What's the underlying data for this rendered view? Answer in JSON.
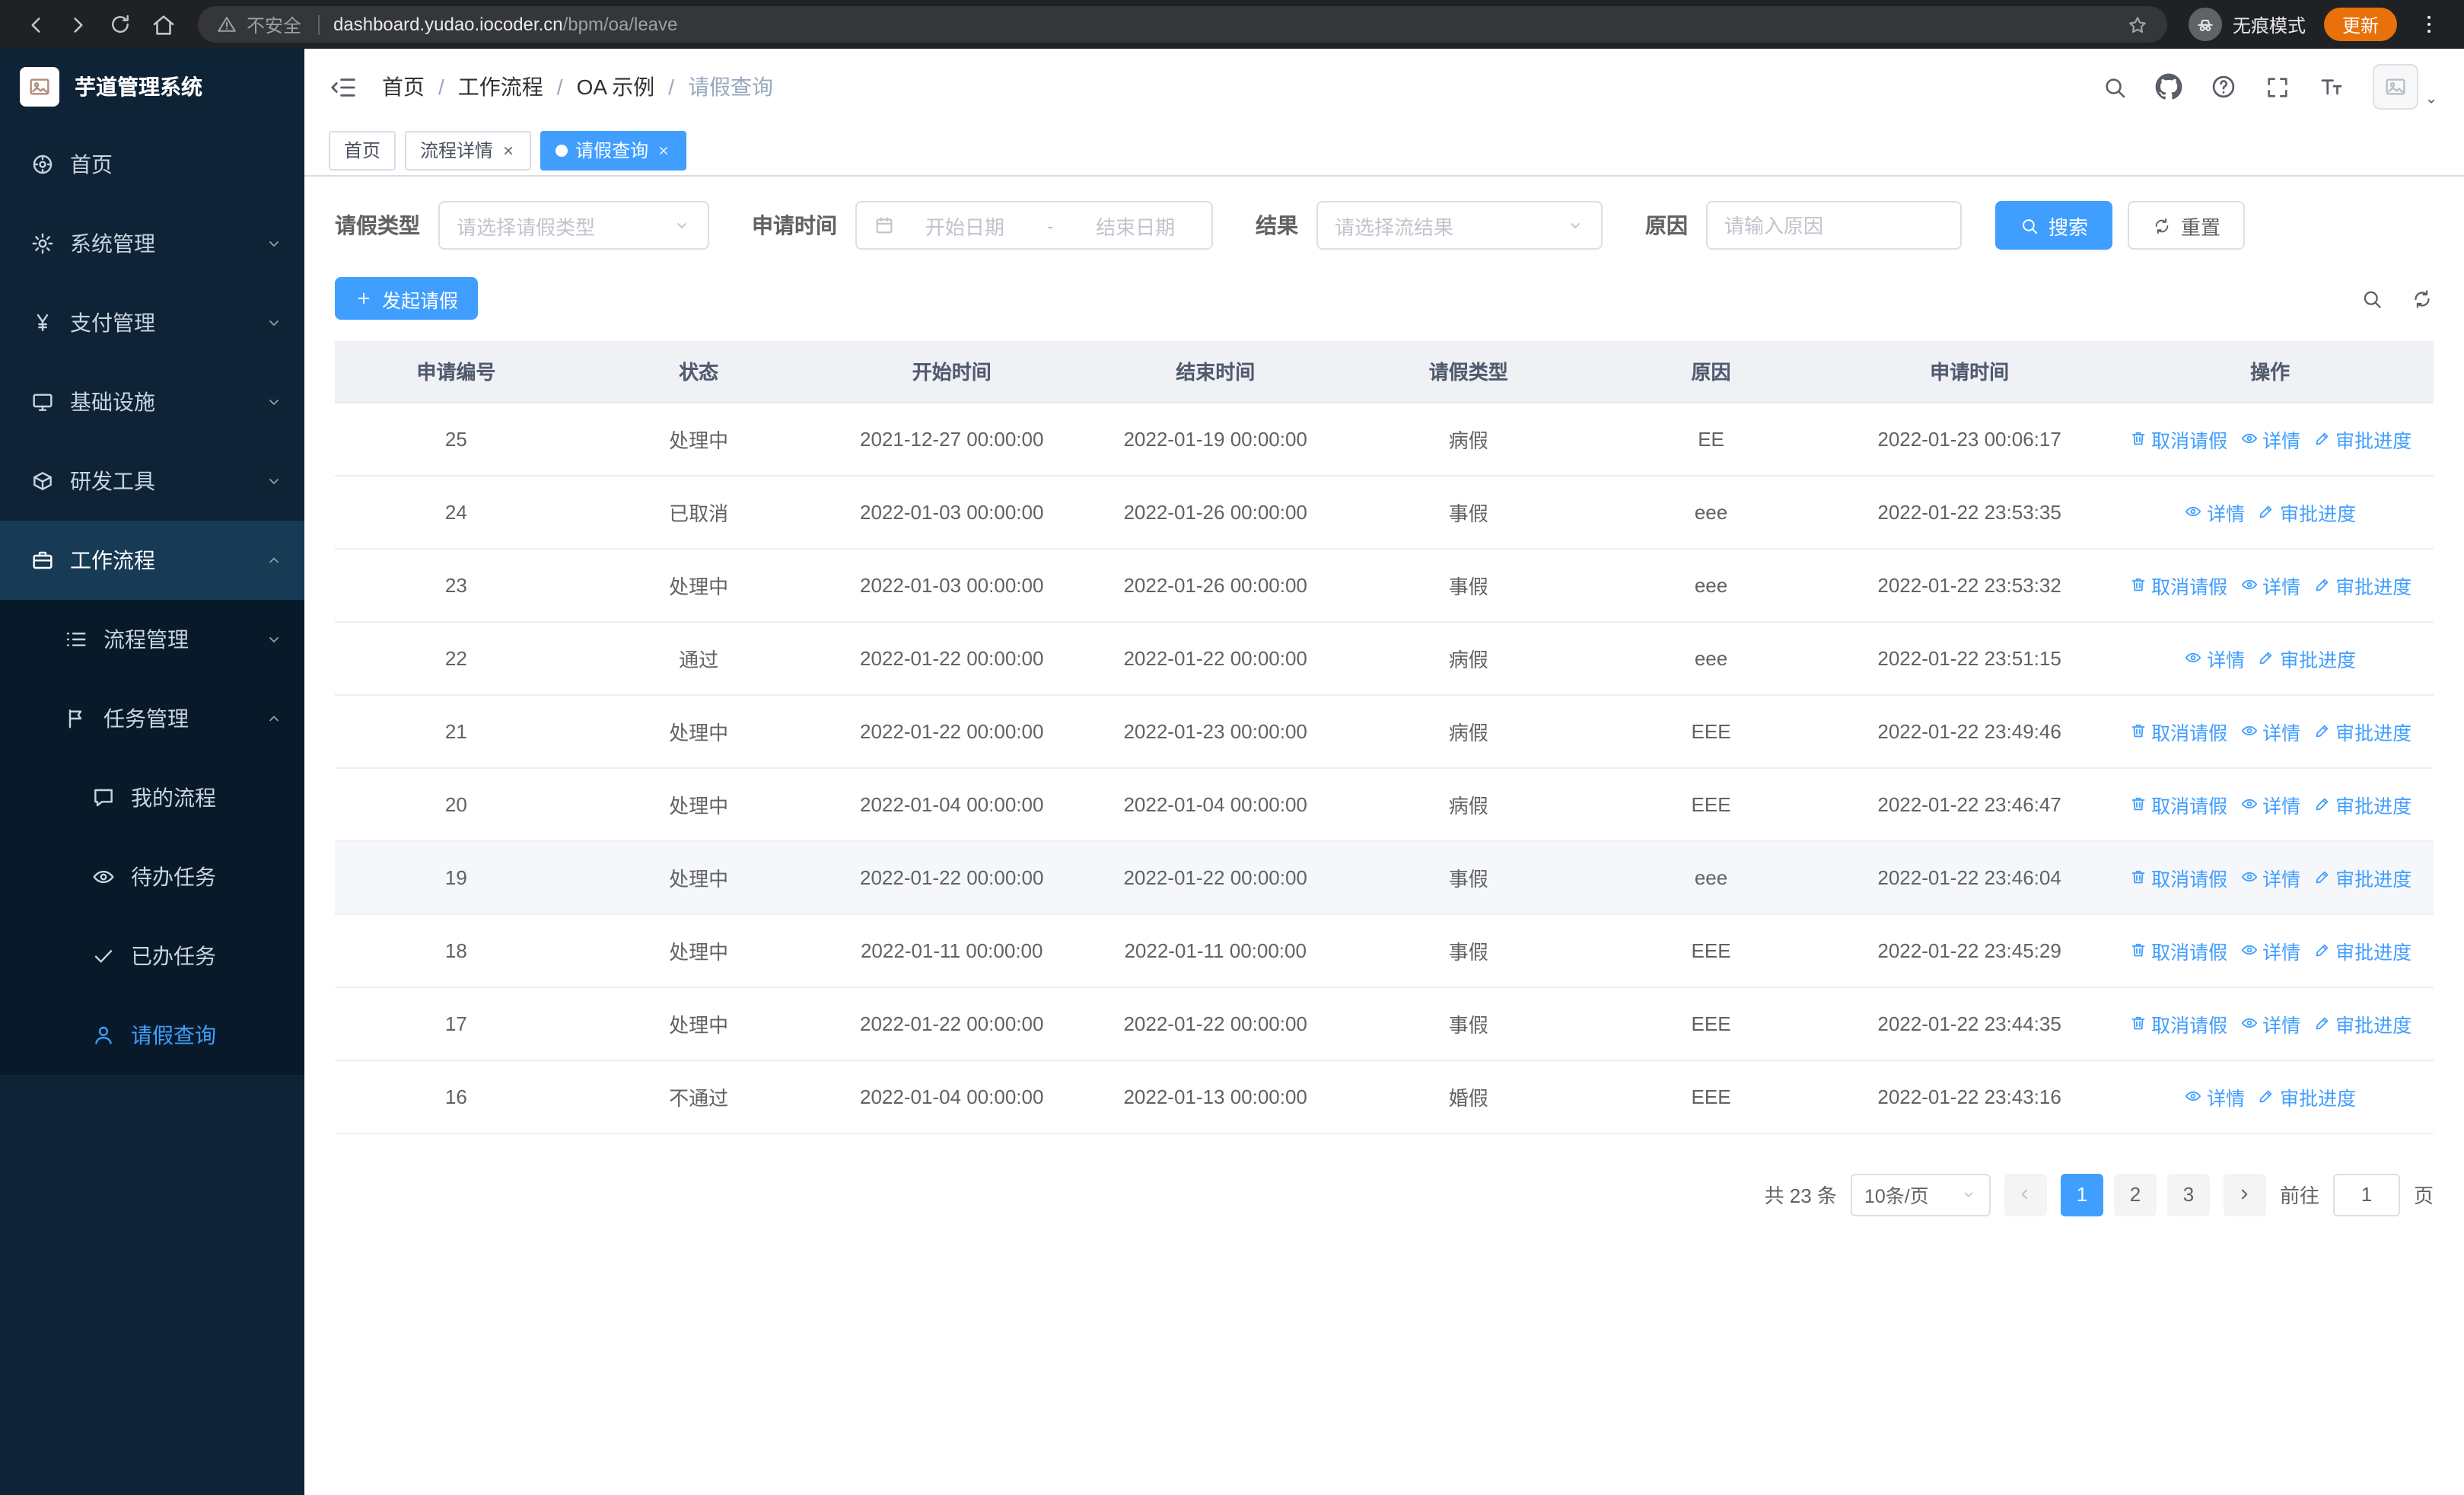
{
  "colors": {
    "primary": "#409eff",
    "sidebar_bg": "#0e2336",
    "submenu_bg": "#081a2a"
  },
  "browser": {
    "security_label": "不安全",
    "url_host": "dashboard.yudao.iocoder.cn",
    "url_path": "/bpm/oa/leave",
    "incognito_label": "无痕模式",
    "update_label": "更新"
  },
  "sidebar": {
    "title": "芋道管理系统",
    "items": [
      {
        "name": "home",
        "label": "首页",
        "icon": "dashboard",
        "level": 1
      },
      {
        "name": "system-management",
        "label": "系统管理",
        "icon": "gear",
        "level": 1,
        "chevron": "down"
      },
      {
        "name": "payment-management",
        "label": "支付管理",
        "icon": "yen",
        "level": 1,
        "chevron": "down"
      },
      {
        "name": "infrastructure",
        "label": "基础设施",
        "icon": "monitor",
        "level": 1,
        "chevron": "down"
      },
      {
        "name": "dev-tools",
        "label": "研发工具",
        "icon": "toolbox",
        "level": 1,
        "chevron": "down"
      },
      {
        "name": "workflow",
        "label": "工作流程",
        "icon": "briefcase",
        "level": 1,
        "chevron": "up",
        "open": true
      },
      {
        "name": "process-management",
        "label": "流程管理",
        "icon": "list",
        "level": 2,
        "chevron": "down"
      },
      {
        "name": "task-management",
        "label": "任务管理",
        "icon": "flag",
        "level": 2,
        "chevron": "up"
      },
      {
        "name": "my-processes",
        "label": "我的流程",
        "icon": "chat",
        "level": 3
      },
      {
        "name": "todo-tasks",
        "label": "待办任务",
        "icon": "eye",
        "level": 3
      },
      {
        "name": "done-tasks",
        "label": "已办任务",
        "icon": "check",
        "level": 3
      },
      {
        "name": "leave-query",
        "label": "请假查询",
        "icon": "user",
        "level": 3,
        "active": true
      }
    ]
  },
  "header": {
    "breadcrumb": [
      "首页",
      "工作流程",
      "OA 示例",
      "请假查询"
    ]
  },
  "tabs": [
    {
      "name": "home",
      "label": "首页"
    },
    {
      "name": "process-detail",
      "label": "流程详情",
      "closable": true
    },
    {
      "name": "leave-query",
      "label": "请假查询",
      "closable": true,
      "active": true
    }
  ],
  "filters": {
    "leave_type_label": "请假类型",
    "leave_type_placeholder": "请选择请假类型",
    "apply_time_label": "申请时间",
    "start_placeholder": "开始日期",
    "range_separator": "-",
    "end_placeholder": "结束日期",
    "result_label": "结果",
    "result_placeholder": "请选择流结果",
    "reason_label": "原因",
    "reason_placeholder": "请输入原因",
    "search_label": "搜索",
    "reset_label": "重置"
  },
  "toolbar": {
    "create_label": "发起请假"
  },
  "table": {
    "columns": [
      "申请编号",
      "状态",
      "开始时间",
      "结束时间",
      "请假类型",
      "原因",
      "申请时间",
      "操作"
    ],
    "op_cancel": "取消请假",
    "op_detail": "详情",
    "op_progress": "审批进度",
    "rows": [
      {
        "id": "25",
        "status": "处理中",
        "start": "2021-12-27 00:00:00",
        "end": "2022-01-19 00:00:00",
        "type": "病假",
        "reason": "EE",
        "applied": "2022-01-23 00:06:17",
        "can_cancel": true,
        "highlight": false
      },
      {
        "id": "24",
        "status": "已取消",
        "start": "2022-01-03 00:00:00",
        "end": "2022-01-26 00:00:00",
        "type": "事假",
        "reason": "eee",
        "applied": "2022-01-22 23:53:35",
        "can_cancel": false,
        "highlight": false
      },
      {
        "id": "23",
        "status": "处理中",
        "start": "2022-01-03 00:00:00",
        "end": "2022-01-26 00:00:00",
        "type": "事假",
        "reason": "eee",
        "applied": "2022-01-22 23:53:32",
        "can_cancel": true,
        "highlight": false
      },
      {
        "id": "22",
        "status": "通过",
        "start": "2022-01-22 00:00:00",
        "end": "2022-01-22 00:00:00",
        "type": "病假",
        "reason": "eee",
        "applied": "2022-01-22 23:51:15",
        "can_cancel": false,
        "highlight": false
      },
      {
        "id": "21",
        "status": "处理中",
        "start": "2022-01-22 00:00:00",
        "end": "2022-01-23 00:00:00",
        "type": "病假",
        "reason": "EEE",
        "applied": "2022-01-22 23:49:46",
        "can_cancel": true,
        "highlight": false
      },
      {
        "id": "20",
        "status": "处理中",
        "start": "2022-01-04 00:00:00",
        "end": "2022-01-04 00:00:00",
        "type": "病假",
        "reason": "EEE",
        "applied": "2022-01-22 23:46:47",
        "can_cancel": true,
        "highlight": false
      },
      {
        "id": "19",
        "status": "处理中",
        "start": "2022-01-22 00:00:00",
        "end": "2022-01-22 00:00:00",
        "type": "事假",
        "reason": "eee",
        "applied": "2022-01-22 23:46:04",
        "can_cancel": true,
        "highlight": true
      },
      {
        "id": "18",
        "status": "处理中",
        "start": "2022-01-11 00:00:00",
        "end": "2022-01-11 00:00:00",
        "type": "事假",
        "reason": "EEE",
        "applied": "2022-01-22 23:45:29",
        "can_cancel": true,
        "highlight": false
      },
      {
        "id": "17",
        "status": "处理中",
        "start": "2022-01-22 00:00:00",
        "end": "2022-01-22 00:00:00",
        "type": "事假",
        "reason": "EEE",
        "applied": "2022-01-22 23:44:35",
        "can_cancel": true,
        "highlight": false
      },
      {
        "id": "16",
        "status": "不通过",
        "start": "2022-01-04 00:00:00",
        "end": "2022-01-13 00:00:00",
        "type": "婚假",
        "reason": "EEE",
        "applied": "2022-01-22 23:43:16",
        "can_cancel": false,
        "highlight": false
      }
    ]
  },
  "pagination": {
    "total_label": "共 23 条",
    "page_size": "10条/页",
    "pages": [
      "1",
      "2",
      "3"
    ],
    "active_page": "1",
    "goto_label": "前往",
    "goto_value": "1",
    "page_suffix": "页"
  }
}
